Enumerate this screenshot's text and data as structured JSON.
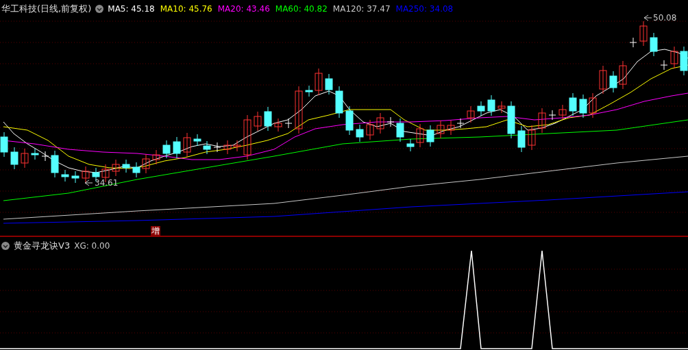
{
  "main_panel": {
    "title": "华工科技(日线,前复权)",
    "indicators": [
      {
        "label": "MA5: 45.18",
        "color": "#ffffff"
      },
      {
        "label": "MA10: 45.76",
        "color": "#ffff00"
      },
      {
        "label": "MA20: 43.46",
        "color": "#ff00ff"
      },
      {
        "label": "MA60: 40.82",
        "color": "#00ff00"
      },
      {
        "label": "MA120: 37.47",
        "color": "#c8c8c8"
      },
      {
        "label": "MA250: 34.08",
        "color": "#0000ff"
      }
    ],
    "high_label": "50.08",
    "low_label": "34.61",
    "signal_mark": "增"
  },
  "sub_panel": {
    "title": "黄金寻龙诀V3",
    "reading": "XG: 0.00"
  }
}
